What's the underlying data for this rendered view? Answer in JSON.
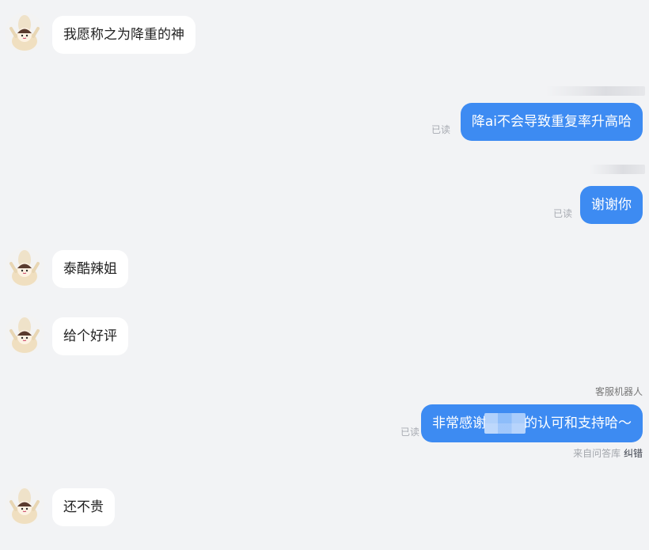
{
  "messages": {
    "m1": {
      "text": "我愿称之为降重的神"
    },
    "m2": {
      "text": "降ai不会导致重复率升高哈",
      "status": "已读"
    },
    "m3": {
      "text": "谢谢你",
      "status": "已读"
    },
    "m4": {
      "text": "泰酷辣姐"
    },
    "m5": {
      "text": "给个好评"
    },
    "m6": {
      "sender": "客服机器人",
      "text_before": "非常感谢",
      "text_after": "的认可和支持哈～",
      "status": "已读",
      "source_label": "来自问答库",
      "correct_link": "纠错"
    },
    "m7": {
      "text": "还不贵"
    }
  },
  "colors": {
    "background": "#f2f3f5",
    "agent_bubble": "#3d8bf2",
    "customer_bubble": "#ffffff",
    "read_status": "#a8abb2"
  }
}
